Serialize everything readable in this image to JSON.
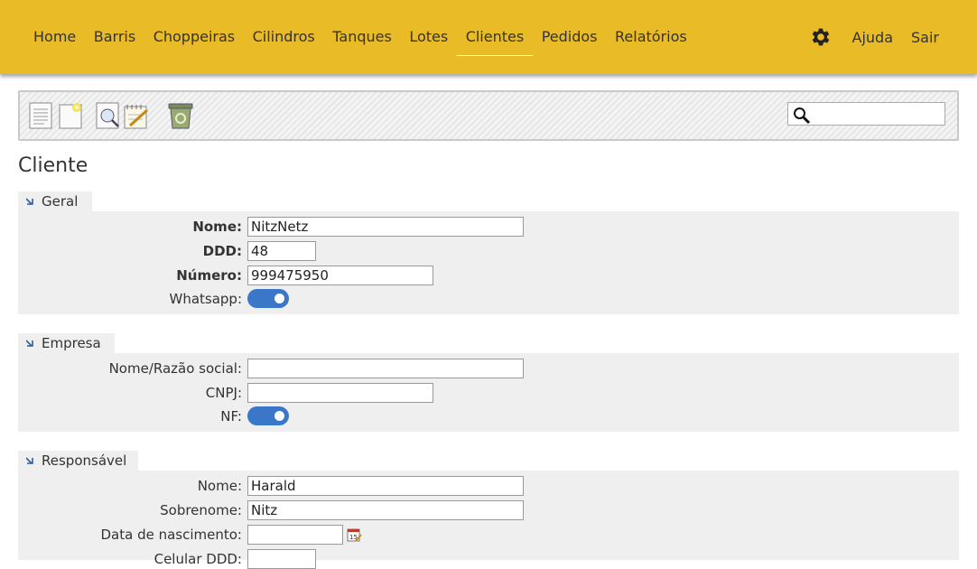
{
  "nav": {
    "items": [
      {
        "label": "Home"
      },
      {
        "label": "Barris"
      },
      {
        "label": "Choppeiras"
      },
      {
        "label": "Cilindros"
      },
      {
        "label": "Tanques"
      },
      {
        "label": "Lotes"
      },
      {
        "label": "Clientes",
        "active": true
      },
      {
        "label": "Pedidos"
      },
      {
        "label": "Relatórios"
      }
    ],
    "settings_icon": "gear-icon",
    "help_label": "Ajuda",
    "logout_label": "Sair",
    "accent_color": "#e9bb27"
  },
  "toolbar": {
    "buttons": [
      "list-icon",
      "new-document-icon",
      "search-document-icon",
      "edit-icon",
      "recycle-bin-icon"
    ],
    "search": {
      "value": "",
      "placeholder": "",
      "icon": "magnifier-icon"
    }
  },
  "page": {
    "title": "Cliente"
  },
  "geral": {
    "title": "Geral",
    "nome_label": "Nome:",
    "nome_value": "NitzNetz",
    "ddd_label": "DDD:",
    "ddd_value": "48",
    "numero_label": "Número:",
    "numero_value": "999475950",
    "whatsapp_label": "Whatsapp:",
    "whatsapp_on": true
  },
  "empresa": {
    "title": "Empresa",
    "razao_label": "Nome/Razão social:",
    "razao_value": "",
    "cnpj_label": "CNPJ:",
    "cnpj_value": "",
    "nf_label": "NF:",
    "nf_on": true
  },
  "responsavel": {
    "title": "Responsável",
    "nome_label": "Nome:",
    "nome_value": "Harald",
    "sobrenome_label": "Sobrenome:",
    "sobrenome_value": "Nitz",
    "nascimento_label": "Data de nascimento:",
    "nascimento_value": "",
    "celular_ddd_label": "Celular DDD:",
    "celular_ddd_value": ""
  },
  "colors": {
    "toggle_on": "#3a77c9",
    "panel_bg": "#efefef"
  }
}
